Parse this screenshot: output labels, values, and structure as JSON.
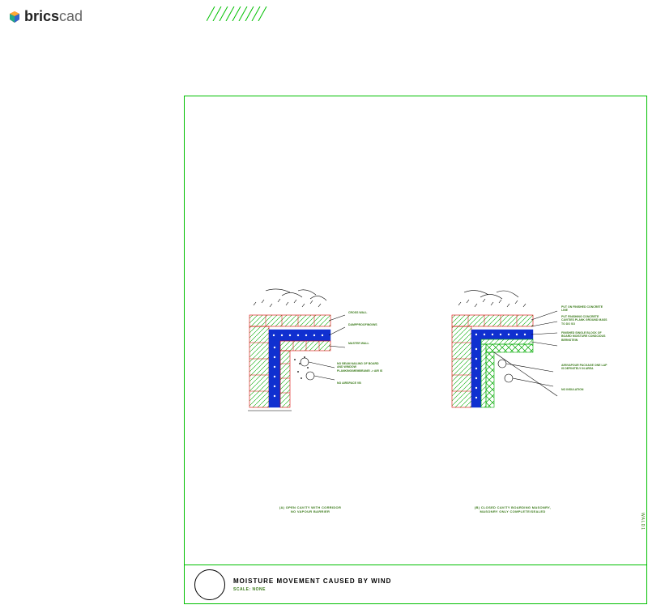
{
  "logo": {
    "text_bold": "brics",
    "text_light": "cad"
  },
  "drawing": {
    "title": "MOISTURE MOVEMENT CAUSED BY WIND",
    "scale": "SCALE: NONE",
    "side_label": "WALD1"
  },
  "detailA": {
    "caption_line1": "(A) OPEN CAVITY WITH CORRIDOR",
    "caption_line2": "NO VAPOUR BARRIER",
    "notes": {
      "a1": "CROSS WALL",
      "a2": "DAMPPROOFING/WS",
      "a3": "MASTER WALL",
      "a4": "NO BEAM NAILING OF BOARD AND WINDOW PLANKING/MEMBRANE/ -> AIR IS",
      "a5": "NO AIRSPACE VB"
    }
  },
  "detailB": {
    "caption_line1": "(B) CLOSED CAVITY BOARDING MASONRY,",
    "caption_line2": "MASONRY ONLY COMPLETE/SEALED",
    "notes": {
      "b1": "PUT ON FINISHED CONCRETE LINE",
      "b2": "PUT FINISHING CONCRETE CAVITIES PLANK GROUND MASS TO DO SO",
      "b3": "FINISHED SINGLE BLOCK OF BOARD MOISTURE CONSCIOUS BERNSTEIN",
      "b4": "AIR/VAPOUR PACKAGE ONE LAP IS DEFINITELY IN AREA",
      "b5": "NO INSULATION"
    }
  }
}
